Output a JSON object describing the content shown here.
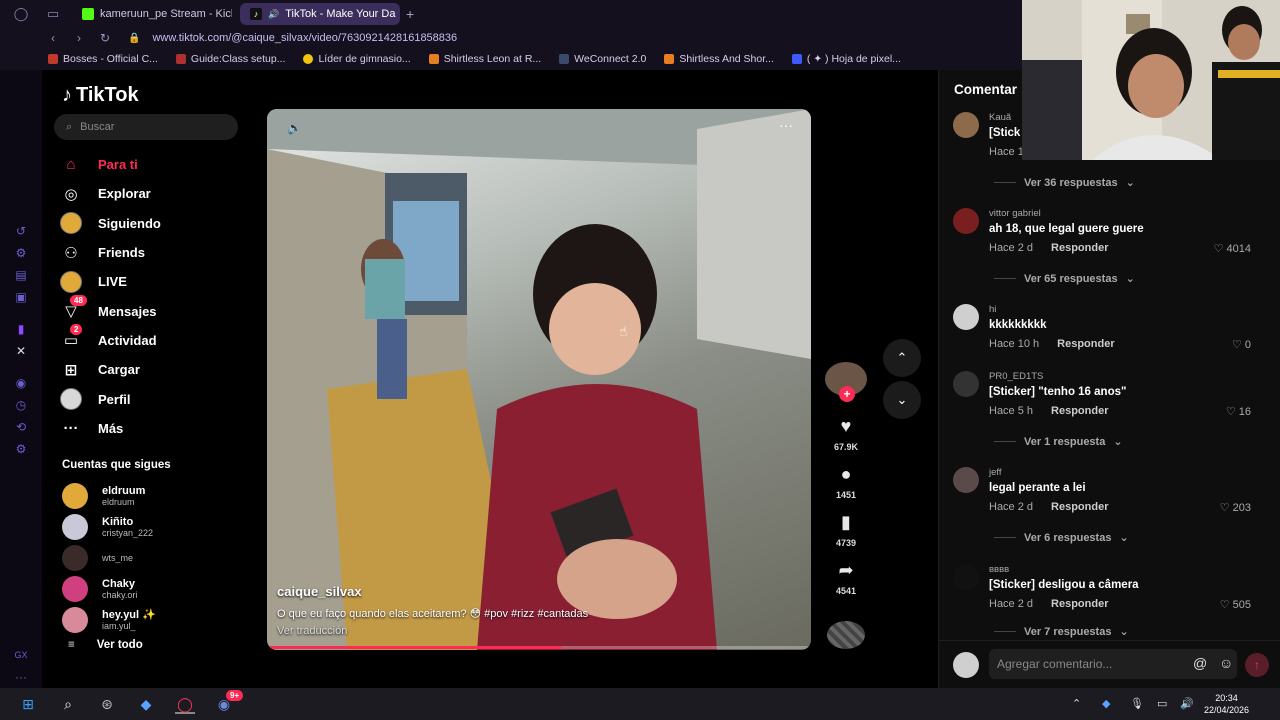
{
  "browser": {
    "tabs": [
      {
        "label": "kameruun_pe Stream - Kick",
        "active": false,
        "color": "#53fc18"
      },
      {
        "label": "TikTok - Make Your Da",
        "active": true,
        "color": "#ffffff"
      }
    ],
    "url": "www.tiktok.com/@caique_silvax/video/7630921428161858836",
    "bookmarks": [
      {
        "label": "Bosses - Official C...",
        "color": "#c0392b"
      },
      {
        "label": "Guide:Class setup...",
        "color": "#b03030"
      },
      {
        "label": "Líder de gimnasio...",
        "color": "#f1c40f"
      },
      {
        "label": "Shirtless Leon at R...",
        "color": "#e67e22"
      },
      {
        "label": "WeConnect 2.0",
        "color": "#3a4a6b"
      },
      {
        "label": "Shirtless And Shor...",
        "color": "#e67e22"
      },
      {
        "label": "( ✦ ) Hoja de pixel...",
        "color": "#3d5afe"
      }
    ]
  },
  "tiktok": {
    "logo": "TikTok",
    "search_placeholder": "Buscar",
    "menu": [
      {
        "label": "Para ti",
        "icon": "home-icon",
        "glyph": "⌂",
        "active": true,
        "badge": ""
      },
      {
        "label": "Explorar",
        "icon": "compass-icon",
        "glyph": "◎",
        "active": false,
        "badge": ""
      },
      {
        "label": "Siguiendo",
        "icon": "following-avatar-icon",
        "glyph": "",
        "active": false,
        "badge": ""
      },
      {
        "label": "Friends",
        "icon": "friends-icon",
        "glyph": "👥",
        "active": false,
        "badge": ""
      },
      {
        "label": "LIVE",
        "icon": "live-avatar-icon",
        "glyph": "",
        "active": false,
        "badge": ""
      },
      {
        "label": "Mensajes",
        "icon": "messages-icon",
        "glyph": "▽",
        "active": false,
        "badge": "48"
      },
      {
        "label": "Actividad",
        "icon": "activity-icon",
        "glyph": "▭",
        "active": false,
        "badge": "2"
      },
      {
        "label": "Cargar",
        "icon": "upload-icon",
        "glyph": "⊞",
        "active": false,
        "badge": ""
      },
      {
        "label": "Perfil",
        "icon": "profile-avatar-icon",
        "glyph": "",
        "active": false,
        "badge": ""
      },
      {
        "label": "Más",
        "icon": "more-icon",
        "glyph": "···",
        "active": false,
        "badge": ""
      }
    ],
    "following_title": "Cuentas que sigues",
    "following": [
      {
        "name": "eldruum",
        "handle": "eldruum",
        "color": "#e1a93a"
      },
      {
        "name": "Kiñito",
        "handle": "cristyan_222",
        "color": "#c8c8d8"
      },
      {
        "name": "",
        "handle": "wts_me",
        "color": "#3a2a2a"
      },
      {
        "name": "Chaky",
        "handle": "chaky.ori",
        "color": "#d04080"
      },
      {
        "name": "hey.yul ✨",
        "handle": "iam.yul_",
        "color": "#d88a9a"
      }
    ],
    "ver_todo": "Ver todo",
    "video": {
      "author": "caique_silvax",
      "caption": "O que eu faço quando elas aceitarem? 😳 #pov  #rizz  #cantadas",
      "translate": "Ver traducción",
      "progress_percent": 54
    },
    "actions": {
      "likes": "67.9K",
      "comments": "1451",
      "saves": "4739",
      "shares": "4541"
    },
    "comments": {
      "title": "Comentar",
      "input_placeholder": "Agregar comentario...",
      "items": [
        {
          "user": "Kauã",
          "text": "[Stick",
          "time": "Hace 1",
          "reply": "",
          "likes": "",
          "more": "Ver 36 respuestas",
          "color": "#8b6b4a"
        },
        {
          "user": "vittor gabriel",
          "text": "ah 18, que legal guere guere",
          "time": "Hace 2 d",
          "reply": "Responder",
          "likes": "4014",
          "more": "Ver 65 respuestas",
          "color": "#7a1f1f"
        },
        {
          "user": "hi",
          "text": "kkkkkkkkk",
          "time": "Hace 10 h",
          "reply": "Responder",
          "likes": "0",
          "more": "",
          "color": "#cfcfcf"
        },
        {
          "user": "PR0_ED1TS",
          "text": "[Sticker] \"tenho 16 anos\"",
          "time": "Hace 5 h",
          "reply": "Responder",
          "likes": "16",
          "more": "Ver 1 respuesta",
          "color": "#333333"
        },
        {
          "user": "jeff",
          "text": "legal perante a lei",
          "time": "Hace 2 d",
          "reply": "Responder",
          "likes": "203",
          "more": "Ver 6 respuestas",
          "color": "#5a4a4a"
        },
        {
          "user": "вввв",
          "text": "[Sticker] desligou a câmera",
          "time": "Hace 2 d",
          "reply": "Responder",
          "likes": "505",
          "more": "Ver 7 respuestas",
          "color": "#111111"
        }
      ]
    }
  },
  "taskbar": {
    "time": "20:34",
    "date": "22/04/2026",
    "chat_badge": "9+"
  },
  "colors": {
    "accent": "#fe2c55",
    "browser_bg": "#15101e",
    "url_color": "#c6bdf0"
  }
}
